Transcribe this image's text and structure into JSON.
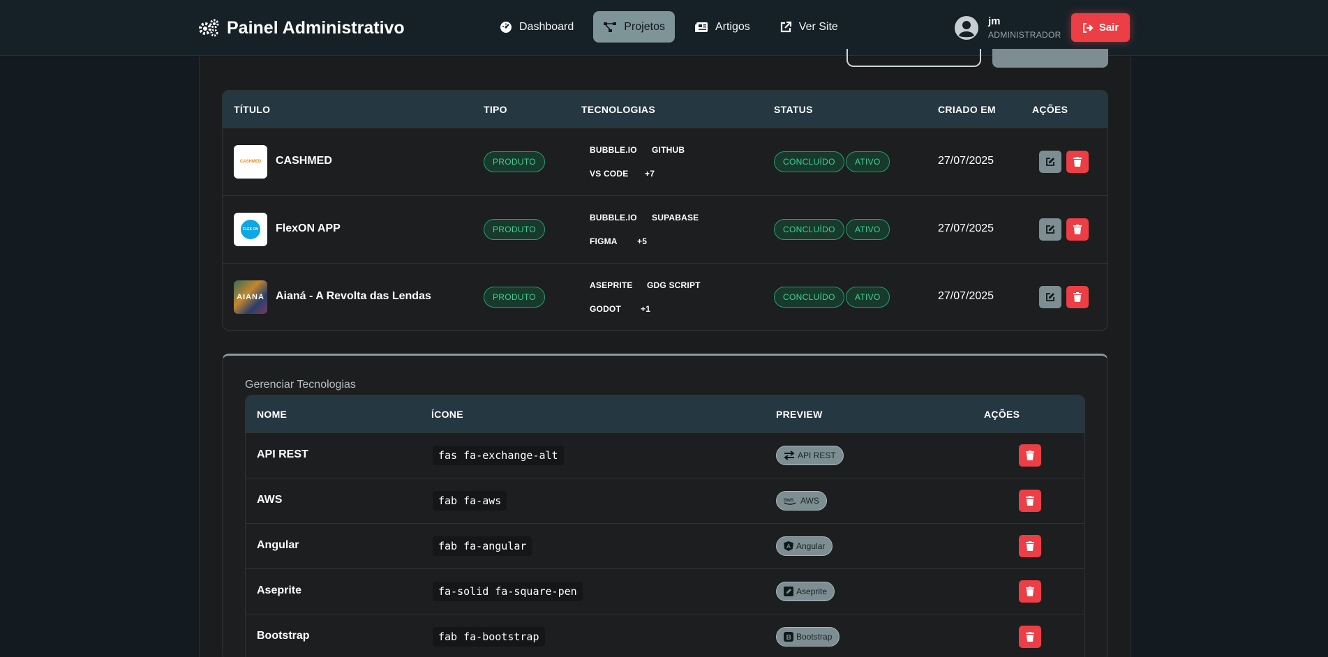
{
  "header": {
    "title": "Painel Administrativo",
    "nav": [
      {
        "label": "Dashboard",
        "icon": "gauge-icon",
        "active": false
      },
      {
        "label": "Projetos",
        "icon": "project-diagram-icon",
        "active": true
      },
      {
        "label": "Artigos",
        "icon": "newspaper-icon",
        "active": false
      },
      {
        "label": "Ver Site",
        "icon": "external-link-icon",
        "active": false
      }
    ],
    "user": {
      "name": "jm",
      "role": "ADMINISTRADOR"
    },
    "logout_label": "Sair"
  },
  "projects": {
    "columns": [
      "TÍTULO",
      "TIPO",
      "TECNOLOGIAS",
      "STATUS",
      "CRIADO EM",
      "AÇÕES"
    ],
    "rows": [
      {
        "title": "CASHMED",
        "thumb_text": "CASHMED",
        "type": "PRODUTO",
        "tech": [
          "BUBBLE.IO",
          "GITHUB",
          "VS CODE",
          "+7"
        ],
        "status": [
          "CONCLUÍDO",
          "ATIVO"
        ],
        "created": "27/07/2025"
      },
      {
        "title": "FlexON APP",
        "thumb_text": "FLEX ON",
        "type": "PRODUTO",
        "tech": [
          "BUBBLE.IO",
          "SUPABASE",
          "FIGMA",
          "+5"
        ],
        "status": [
          "CONCLUÍDO",
          "ATIVO"
        ],
        "created": "27/07/2025"
      },
      {
        "title": "Aianá - A Revolta das Lendas",
        "thumb_text": "AIANA",
        "type": "PRODUTO",
        "tech": [
          "ASEPRITE",
          "GDG SCRIPT",
          "GODOT",
          "+1"
        ],
        "status": [
          "CONCLUÍDO",
          "ATIVO"
        ],
        "created": "27/07/2025"
      }
    ]
  },
  "technologies": {
    "title": "Gerenciar Tecnologias",
    "columns": [
      "NOME",
      "ÍCONE",
      "PREVIEW",
      "AÇÕES"
    ],
    "rows": [
      {
        "name": "API REST",
        "icon_class": "fas fa-exchange-alt",
        "preview": "API REST",
        "preview_icon": "exchange-icon"
      },
      {
        "name": "AWS",
        "icon_class": "fab fa-aws",
        "preview": "AWS",
        "preview_icon": "aws-icon"
      },
      {
        "name": "Angular",
        "icon_class": "fab fa-angular",
        "preview": "Angular",
        "preview_icon": "angular-icon"
      },
      {
        "name": "Aseprite",
        "icon_class": "fa-solid fa-square-pen",
        "preview": "Aseprite",
        "preview_icon": "square-pen-icon"
      },
      {
        "name": "Bootstrap",
        "icon_class": "fab fa-bootstrap",
        "preview": "Bootstrap",
        "preview_icon": "bootstrap-icon"
      }
    ]
  },
  "colors": {
    "accent": "#7f9499",
    "danger": "#ec3e44",
    "success": "#3fd08f",
    "header_bg": "#253740"
  }
}
